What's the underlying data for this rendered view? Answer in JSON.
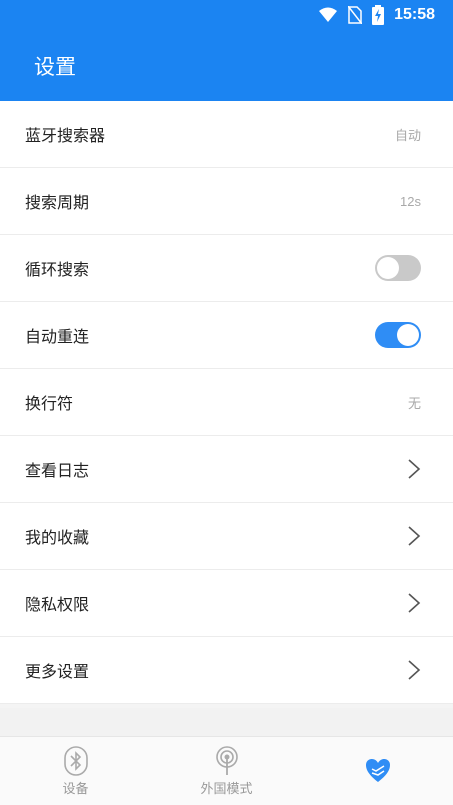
{
  "status_bar": {
    "time": "15:58"
  },
  "header": {
    "title": "设置"
  },
  "settings": [
    {
      "label": "蓝牙搜索器",
      "value": "自动"
    },
    {
      "label": "搜索周期",
      "value": "12s"
    },
    {
      "label": "循环搜索",
      "toggle": "off"
    },
    {
      "label": "自动重连",
      "toggle": "on"
    },
    {
      "label": "换行符",
      "value": "无"
    },
    {
      "label": "查看日志"
    },
    {
      "label": "我的收藏"
    },
    {
      "label": "隐私权限"
    },
    {
      "label": "更多设置"
    }
  ],
  "nav": {
    "devices_label": "设备",
    "external_label": "外国模式"
  },
  "colors": {
    "primary": "#1b84f2",
    "toggle_on": "#2f8df5",
    "toggle_off": "#c9c9c9"
  }
}
